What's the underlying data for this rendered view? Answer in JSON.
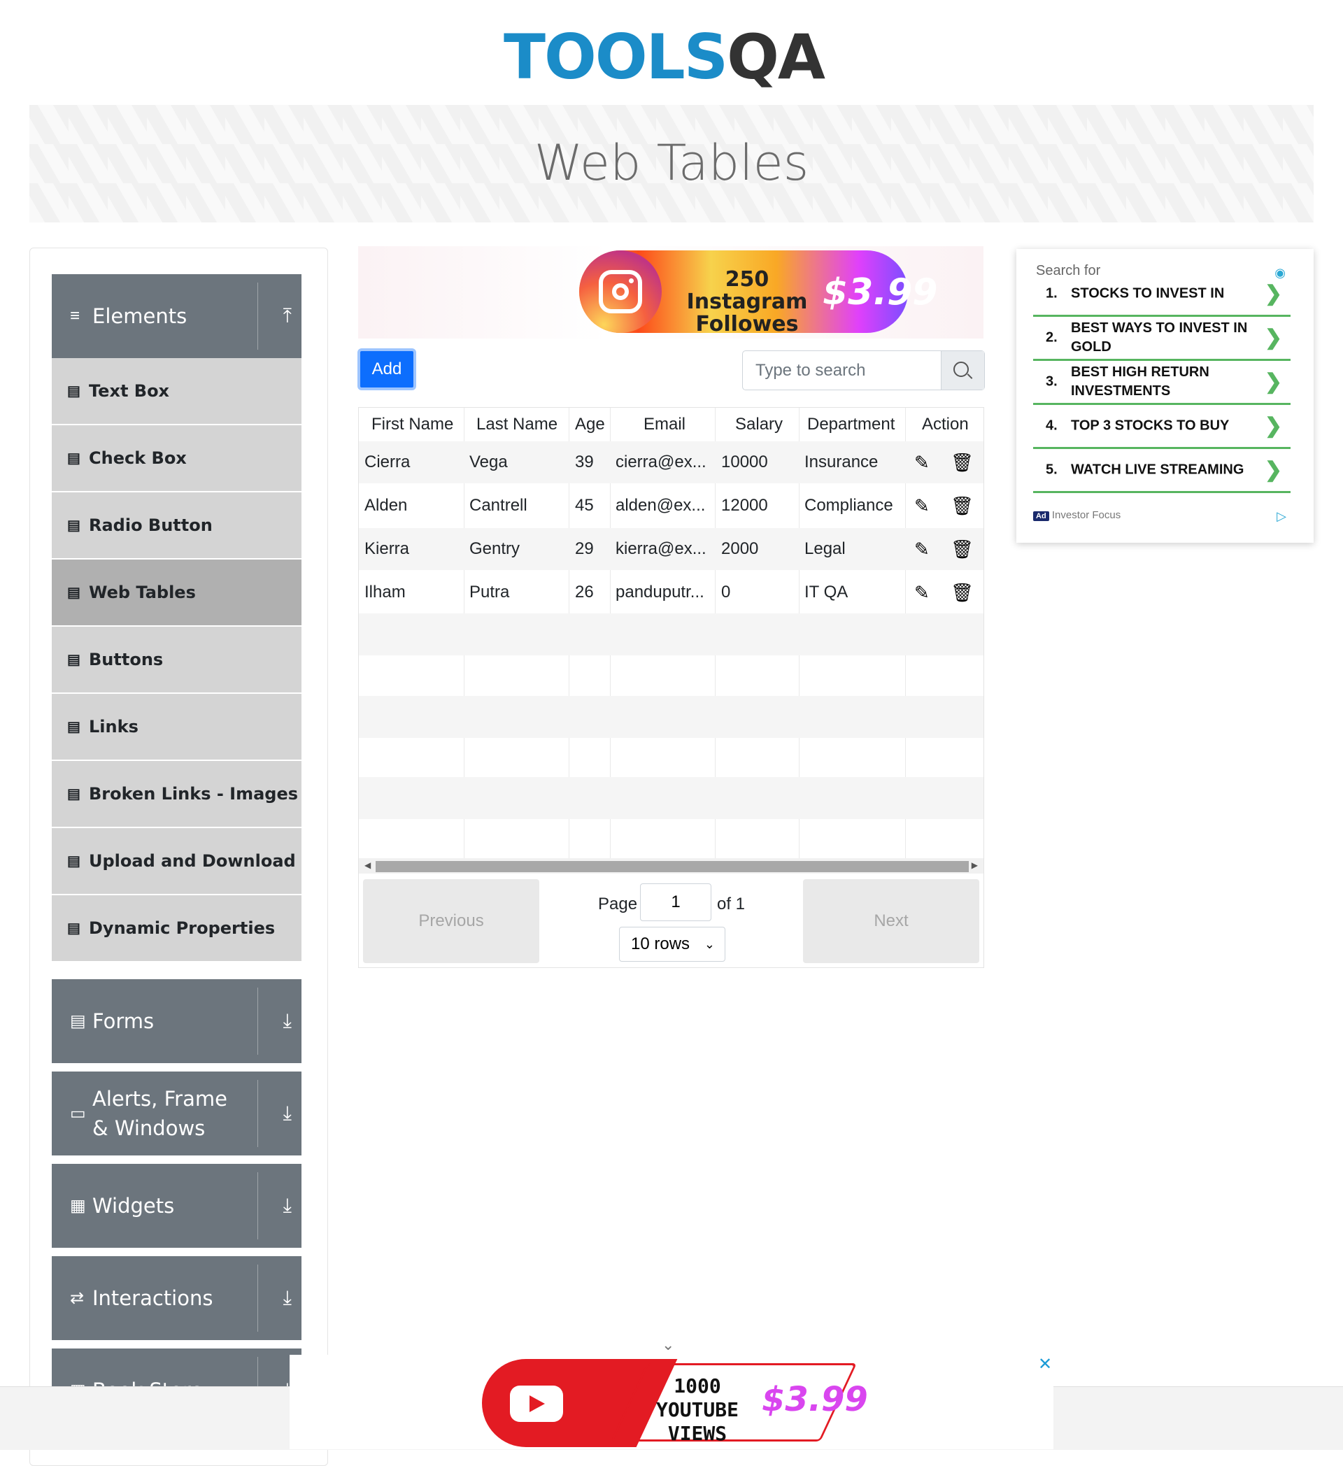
{
  "logo": {
    "tools": "TOOLS",
    "qa": "QA"
  },
  "page_title": "Web Tables",
  "sidebar": {
    "groups": [
      {
        "label": "Elements",
        "icon": "≡",
        "arrow": "⤒"
      },
      {
        "label": "Forms",
        "icon": "▤",
        "arrow": "⤓"
      },
      {
        "label": "Alerts, Frame & Windows",
        "icon": "▭",
        "arrow": "⤓"
      },
      {
        "label": "Widgets",
        "icon": "▦",
        "arrow": "⤓"
      },
      {
        "label": "Interactions",
        "icon": "⇄",
        "arrow": "⤓"
      },
      {
        "label": "Book Store",
        "icon": "▥",
        "arrow": "⤓"
      }
    ],
    "items": [
      {
        "label": "Text Box"
      },
      {
        "label": "Check Box"
      },
      {
        "label": "Radio Button"
      },
      {
        "label": "Web Tables"
      },
      {
        "label": "Buttons"
      },
      {
        "label": "Links"
      },
      {
        "label": "Broken Links - Images"
      },
      {
        "label": "Upload and Download"
      },
      {
        "label": "Dynamic Properties"
      }
    ]
  },
  "ad_top": {
    "line1": "250 Instagram",
    "line2": "Followes",
    "price": "$3.99"
  },
  "toolbar": {
    "add_label": "Add",
    "search_placeholder": "Type to search"
  },
  "table": {
    "headers": [
      "First Name",
      "Last Name",
      "Age",
      "Email",
      "Salary",
      "Department",
      "Action"
    ],
    "rows": [
      [
        "Cierra",
        "Vega",
        "39",
        "cierra@ex...",
        "10000",
        "Insurance"
      ],
      [
        "Alden",
        "Cantrell",
        "45",
        "alden@ex...",
        "12000",
        "Compliance"
      ],
      [
        "Kierra",
        "Gentry",
        "29",
        "kierra@ex...",
        "2000",
        "Legal"
      ],
      [
        "Ilham",
        "Putra",
        "26",
        "panduputr...",
        "0",
        "IT QA"
      ]
    ],
    "icons": {
      "edit": "✎",
      "delete": "🗑"
    }
  },
  "pagination": {
    "previous": "Previous",
    "next": "Next",
    "page_label": "Page",
    "page_value": "1",
    "of_label": "of 1",
    "rows_option": "10 rows"
  },
  "side_ad": {
    "search_for": "Search for",
    "items": [
      {
        "num": "1.",
        "text": "STOCKS TO INVEST IN"
      },
      {
        "num": "2.",
        "text": "BEST WAYS TO INVEST IN GOLD"
      },
      {
        "num": "3.",
        "text": "BEST HIGH RETURN INVESTMENTS"
      },
      {
        "num": "4.",
        "text": "TOP 3 STOCKS TO BUY"
      },
      {
        "num": "5.",
        "text": "WATCH LIVE STREAMING"
      }
    ],
    "ad_badge": "Ad",
    "sponsor": "Investor Focus"
  },
  "ad_bottom": {
    "line1": "1000",
    "line2": "YOUTUBE VIEWS",
    "price": "$3.99"
  },
  "colors": {
    "accent": "#0d6efd",
    "sidebar_group": "#6c757d",
    "menu_item": "#d4d4d4",
    "ad_green": "#57b560"
  }
}
